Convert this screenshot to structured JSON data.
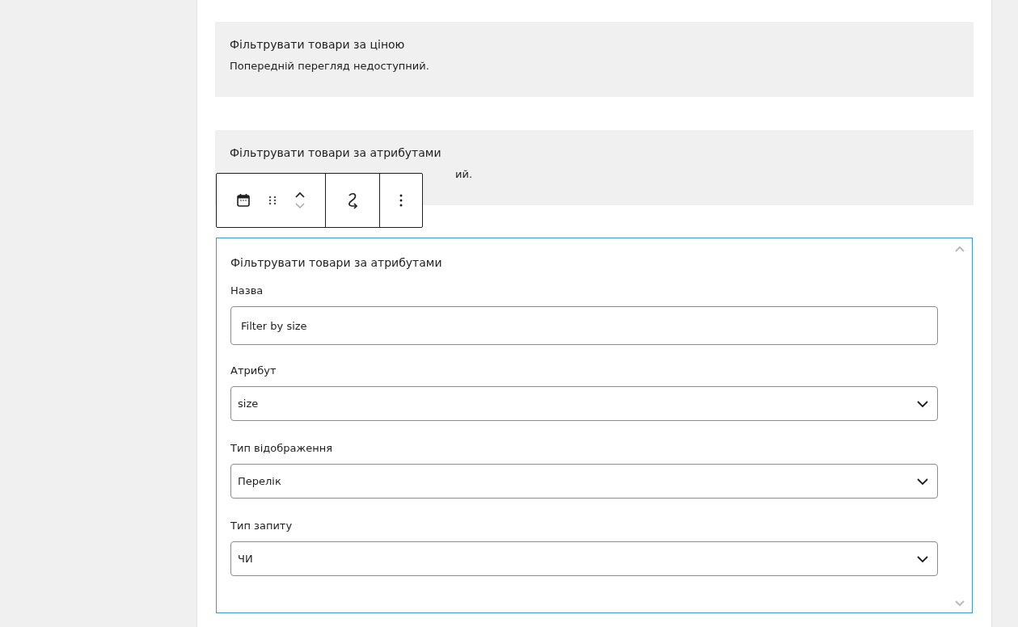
{
  "blocks": [
    {
      "title": "Фільтрувати товари за ціною",
      "description": "Попередній перегляд недоступний."
    },
    {
      "title": "Фільтрувати товари за атрибутами",
      "description": "ий."
    }
  ],
  "toolbar": {
    "groups": [
      {
        "items": [
          {
            "kind": "calendar"
          },
          {
            "kind": "drag"
          },
          {
            "kind": "mover"
          }
        ]
      },
      {
        "items": [
          {
            "kind": "transform"
          }
        ]
      },
      {
        "items": [
          {
            "kind": "more"
          }
        ]
      }
    ]
  },
  "panel": {
    "title": "Фільтрувати товари за атрибутами",
    "fields": [
      {
        "kind": "text",
        "label": "Назва",
        "value": "Filter by size"
      },
      {
        "kind": "select",
        "label": "Атрибут",
        "value": "size"
      },
      {
        "kind": "select",
        "label": "Тип відображення",
        "value": "Перелік"
      },
      {
        "kind": "select",
        "label": "Тип запиту",
        "value": "ЧИ"
      }
    ]
  }
}
